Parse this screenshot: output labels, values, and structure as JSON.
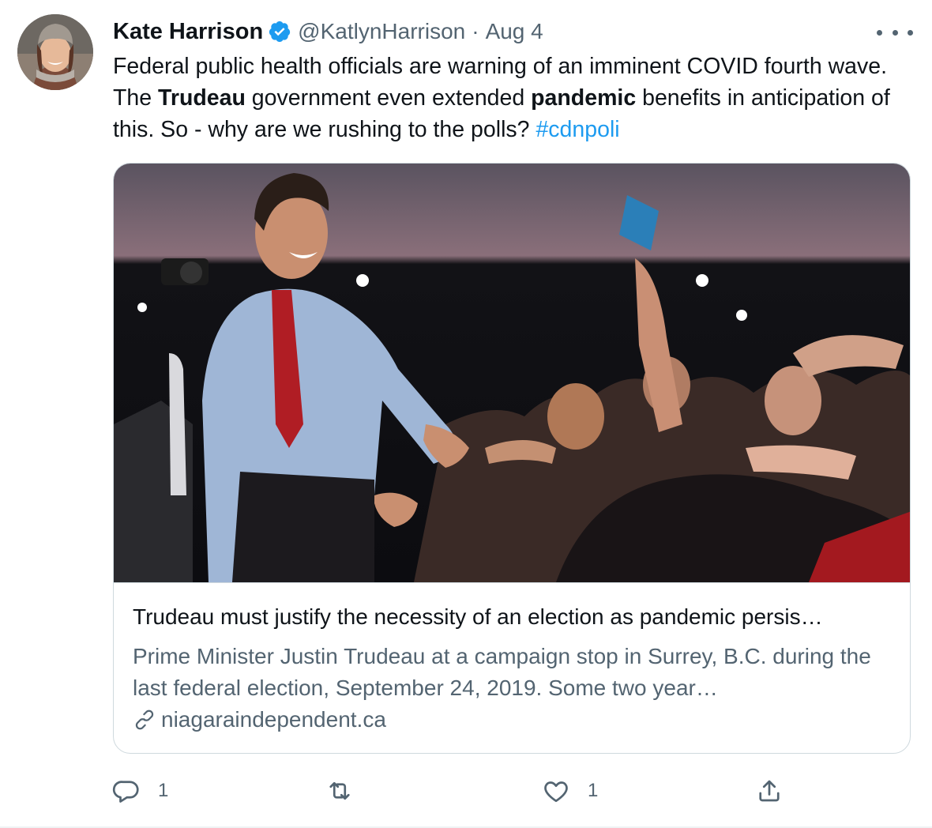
{
  "author": {
    "name": "Kate Harrison",
    "handle": "@KatlynHarrison",
    "separator": "·",
    "date": "Aug 4",
    "verified_color": "#1d9bf0"
  },
  "tweet": {
    "part1": "Federal public health officials are warning of an imminent COVID fourth wave. The ",
    "bold1": "Trudeau",
    "part2": " government even extended ",
    "bold2": "pandemic",
    "part3": " benefits in anticipation of this. So - why are we rushing to the polls? ",
    "hashtag": "#cdnpoli"
  },
  "card": {
    "title": "Trudeau must justify the necessity of an election as pandemic persis…",
    "description": "Prime Minister Justin Trudeau at a campaign stop in Surrey, B.C. during the last federal election, September 24, 2019. Some two year…",
    "domain": "niagaraindependent.ca"
  },
  "actions": {
    "reply_count": "1",
    "retweet_count": "",
    "like_count": "1"
  },
  "colors": {
    "accent": "#1d9bf0",
    "secondary_text": "#536471",
    "border": "#cfd9de"
  },
  "icons": {
    "more": "more-icon",
    "reply": "reply-icon",
    "retweet": "retweet-icon",
    "like": "like-icon",
    "share": "share-icon",
    "link": "link-icon",
    "verified": "verified-badge-icon"
  }
}
